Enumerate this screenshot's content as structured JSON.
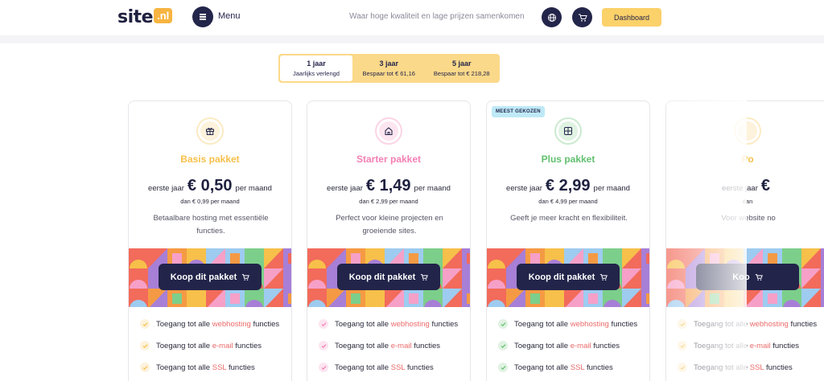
{
  "header": {
    "logo_text": "site",
    "logo_suffix": ".nl",
    "menu_label": "Menu",
    "tagline": "Waar hoge kwaliteit en lage prijzen samenkomen",
    "dashboard_label": "Dashboard"
  },
  "periods": [
    {
      "title": "1 jaar",
      "sub": "Jaarlijks verlengd",
      "active": true
    },
    {
      "title": "3 jaar",
      "sub": "Bespaar tot € 61,16",
      "active": false
    },
    {
      "title": "5 jaar",
      "sub": "Bespaar tot € 218,28",
      "active": false
    }
  ],
  "plans": [
    {
      "name": "Basis pakket",
      "color": "#f7c04a",
      "icon": "gift-icon",
      "price_pre": "eerste jaar",
      "price": "€ 0,50",
      "price_post": "per maand",
      "then": "dan € 0,99 per maand",
      "desc": "Betaalbare hosting met essentiële functies.",
      "buy_label": "Koop dit pakket",
      "badge": ""
    },
    {
      "name": "Starter pakket",
      "color": "#f47fb4",
      "icon": "house-icon",
      "price_pre": "eerste jaar",
      "price": "€ 1,49",
      "price_post": "per maand",
      "then": "dan € 2,99 per maand",
      "desc": "Perfect voor kleine projecten en groeiende sites.",
      "buy_label": "Koop dit pakket",
      "badge": ""
    },
    {
      "name": "Plus pakket",
      "color": "#62c06f",
      "icon": "grid-plus-icon",
      "price_pre": "eerste jaar",
      "price": "€ 2,99",
      "price_post": "per maand",
      "then": "dan € 4,99 per maand",
      "desc": "Geeft je meer kracht en flexibiliteit.",
      "buy_label": "Koop dit pakket",
      "badge": "MEEST GEKOZEN"
    },
    {
      "name": "Po",
      "color": "#f7c04a",
      "icon": "partial-icon",
      "price_pre": "eerste jaar",
      "price": "€",
      "price_post": "",
      "then": "dan",
      "desc": "Voor website no",
      "buy_label": "Koo",
      "badge": ""
    }
  ],
  "features": {
    "f1_pre": "Toegang tot alle",
    "f1_hl": "webhosting",
    "f1_post": "functies",
    "f2_pre": "Toegang tot alle",
    "f2_hl": "e-mail",
    "f2_post": "functies",
    "f3_pre": "Toegang tot alle",
    "f3_hl": "SSL",
    "f3_post": "functies"
  },
  "colors": {
    "navy": "#23254a",
    "accent_yellow": "#fbd16a",
    "highlight_red": "#ec6a6a"
  }
}
